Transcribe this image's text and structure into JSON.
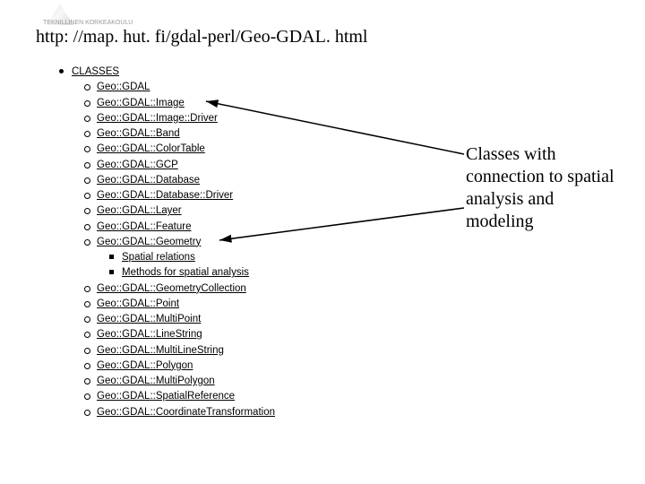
{
  "logo_text": "TEKNILLINEN KORKEAKOULU",
  "url": "http: //map. hut. fi/gdal-perl/Geo-GDAL. html",
  "annotation": "Classes with connection to spatial analysis and modeling",
  "nav": {
    "top": "CLASSES",
    "items": [
      "Geo::GDAL",
      "Geo::GDAL::Image",
      "Geo::GDAL::Image::Driver",
      "Geo::GDAL::Band",
      "Geo::GDAL::ColorTable",
      "Geo::GDAL::GCP",
      "Geo::GDAL::Database",
      "Geo::GDAL::Database::Driver",
      "Geo::GDAL::Layer",
      "Geo::GDAL::Feature",
      "Geo::GDAL::Geometry"
    ],
    "geometry_sub": [
      "Spatial relations",
      "Methods for spatial analysis"
    ],
    "items2": [
      "Geo::GDAL::GeometryCollection",
      "Geo::GDAL::Point",
      "Geo::GDAL::MultiPoint",
      "Geo::GDAL::LineString",
      "Geo::GDAL::MultiLineString",
      "Geo::GDAL::Polygon",
      "Geo::GDAL::MultiPolygon",
      "Geo::GDAL::SpatialReference",
      "Geo::GDAL::CoordinateTransformation"
    ]
  }
}
